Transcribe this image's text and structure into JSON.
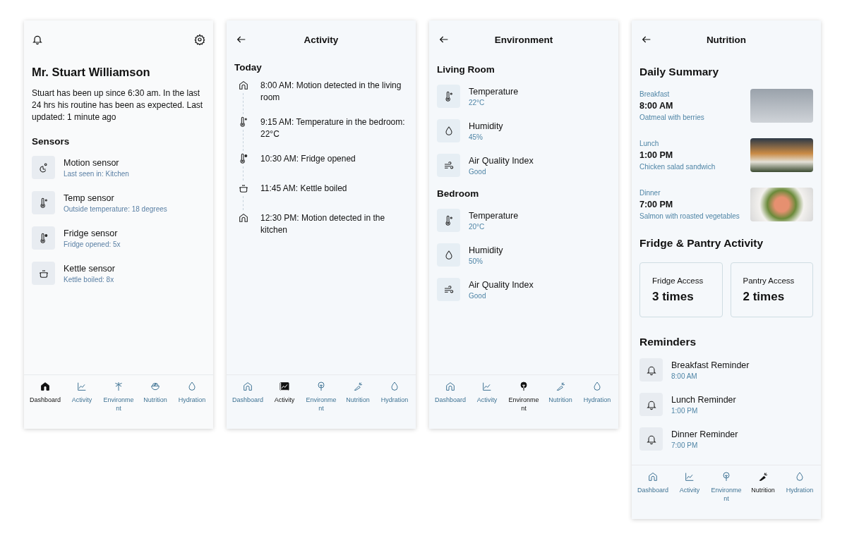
{
  "screens": [
    {
      "kind": "dashboard",
      "name": "Mr. Stuart Williamson",
      "summary": "Stuart has been up since 6:30 am. In the last 24 hrs his routine has been as expected. Last updated: 1 minute ago",
      "section": "Sensors",
      "sensors": [
        {
          "kind": "motion",
          "title": "Motion sensor",
          "detail": "Last seen in: Kitchen"
        },
        {
          "kind": "temperature",
          "title": "Temp sensor",
          "detail": "Outside temperature: 18 degrees"
        },
        {
          "kind": "fridge",
          "title": "Fridge sensor",
          "detail": "Fridge opened: 5x"
        },
        {
          "kind": "kettle",
          "title": "Kettle sensor",
          "detail": "Kettle boiled: 8x"
        }
      ],
      "nav": [
        {
          "label": "Dashboard",
          "selected": true
        },
        {
          "label": "Activity",
          "selected": false
        },
        {
          "label": "Environment",
          "selected": false
        },
        {
          "label": "Nutrition",
          "selected": false
        },
        {
          "label": "Hydration",
          "selected": false
        }
      ]
    },
    {
      "kind": "activity",
      "title": "Activity",
      "section": "Today",
      "events": [
        {
          "kind": "motion",
          "text": "8:00 AM: Motion detected in the living room"
        },
        {
          "kind": "temperature",
          "text": "9:15 AM: Temperature in the bedroom: 22°C"
        },
        {
          "kind": "fridge",
          "text": "10:30 AM: Fridge opened"
        },
        {
          "kind": "kettle",
          "text": "11:45 AM: Kettle boiled"
        },
        {
          "kind": "motion",
          "text": "12:30 PM: Motion detected in the kitchen"
        }
      ],
      "nav": [
        {
          "label": "Dashboard",
          "selected": false
        },
        {
          "label": "Activity",
          "selected": true
        },
        {
          "label": "Environment",
          "selected": false
        },
        {
          "label": "Nutrition",
          "selected": false
        },
        {
          "label": "Hydration",
          "selected": false
        }
      ]
    },
    {
      "kind": "environment",
      "title": "Environment",
      "rooms": [
        {
          "name": "Living Room",
          "readings": [
            {
              "kind": "temperature",
              "label": "Temperature",
              "value": "22°C"
            },
            {
              "kind": "humidity",
              "label": "Humidity",
              "value": "45%"
            },
            {
              "kind": "air",
              "label": "Air Quality Index",
              "value": "Good"
            }
          ]
        },
        {
          "name": "Bedroom",
          "readings": [
            {
              "kind": "temperature",
              "label": "Temperature",
              "value": "20°C"
            },
            {
              "kind": "humidity",
              "label": "Humidity",
              "value": "50%"
            },
            {
              "kind": "air",
              "label": "Air Quality Index",
              "value": "Good"
            }
          ]
        }
      ],
      "nav": [
        {
          "label": "Dashboard",
          "selected": false
        },
        {
          "label": "Activity",
          "selected": false
        },
        {
          "label": "Environment",
          "selected": true
        },
        {
          "label": "Nutrition",
          "selected": false
        },
        {
          "label": "Hydration",
          "selected": false
        }
      ]
    },
    {
      "kind": "nutrition",
      "title": "Nutrition",
      "summary_title": "Daily Summary",
      "meals": [
        {
          "meal": "Breakfast",
          "time": "8:00 AM",
          "food": "Oatmeal with berries"
        },
        {
          "meal": "Lunch",
          "time": "1:00 PM",
          "food": "Chicken salad sandwich"
        },
        {
          "meal": "Dinner",
          "time": "7:00 PM",
          "food": "Salmon with roasted vegetables"
        }
      ],
      "activity_title": "Fridge & Pantry Activity",
      "access": [
        {
          "label": "Fridge Access",
          "count": "3 times"
        },
        {
          "label": "Pantry Access",
          "count": "2 times"
        }
      ],
      "reminders_title": "Reminders",
      "reminders": [
        {
          "title": "Breakfast Reminder",
          "time": "8:00 AM"
        },
        {
          "title": "Lunch Reminder",
          "time": "1:00 PM"
        },
        {
          "title": "Dinner Reminder",
          "time": "7:00 PM"
        }
      ],
      "nav": [
        {
          "label": "Dashboard",
          "selected": false
        },
        {
          "label": "Activity",
          "selected": false
        },
        {
          "label": "Environment",
          "selected": false
        },
        {
          "label": "Nutrition",
          "selected": true
        },
        {
          "label": "Hydration",
          "selected": false
        }
      ]
    }
  ]
}
